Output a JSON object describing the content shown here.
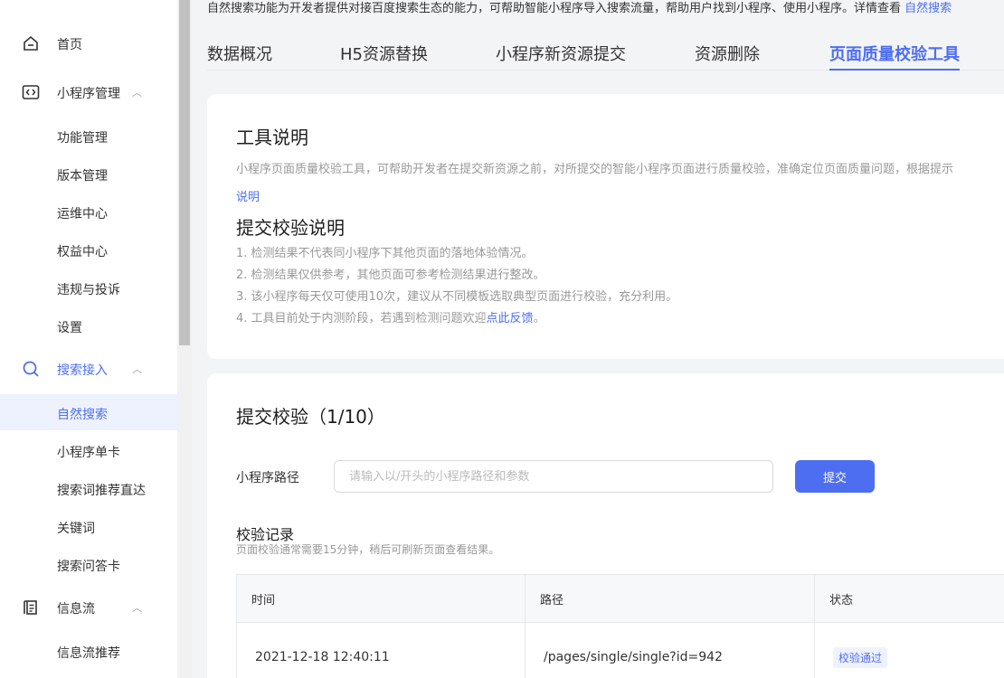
{
  "intro": {
    "text": "自然搜索功能为开发者提供对接百度搜索生态的能力，可帮助智能小程序导入搜索流量，帮助用户找到小程序、使用小程序。详情查看 ",
    "link": "自然搜索"
  },
  "sidebar": {
    "home": "首页",
    "groups": [
      {
        "label": "小程序管理",
        "icon": "code-brackets-icon",
        "items": [
          "功能管理",
          "版本管理",
          "运维中心",
          "权益中心",
          "违规与投诉",
          "设置"
        ]
      },
      {
        "label": "搜索接入",
        "icon": "search-icon",
        "items": [
          "自然搜索",
          "小程序单卡",
          "搜索词推荐直达",
          "关键词",
          "搜索问答卡"
        ]
      },
      {
        "label": "信息流",
        "icon": "list-icon",
        "items": [
          "信息流推荐"
        ]
      }
    ]
  },
  "tabs": [
    "数据概况",
    "H5资源替换",
    "小程序新资源提交",
    "资源删除",
    "页面质量校验工具"
  ],
  "tool": {
    "title": "工具说明",
    "desc": "小程序页面质量校验工具，可帮助开发者在提交新资源之前，对所提交的智能小程序页面进行质量校验，准确定位页面质量问题，根据提示",
    "desc_link": "说明"
  },
  "rules": {
    "title": "提交校验说明",
    "items": [
      "1. 检测结果不代表同小程序下其他页面的落地体验情况。",
      "2. 检测结果仅供参考，其他页面可参考检测结果进行整改。",
      "3. 该小程序每天仅可使用10次，建议从不同模板选取典型页面进行校验，充分利用。"
    ],
    "item4_prefix": "4. 工具目前处于内测阶段，若遇到检测问题欢迎",
    "item4_link": "点此反馈",
    "item4_suffix": "。"
  },
  "submit": {
    "title": "提交校验（1/10）",
    "path_label": "小程序路径",
    "placeholder": "请输入以/开头的小程序路径和参数",
    "button": "提交"
  },
  "records": {
    "title": "校验记录",
    "note": "页面校验通常需要15分钟，稍后可刷新页面查看结果。",
    "columns": [
      "时间",
      "路径",
      "状态"
    ],
    "rows": [
      {
        "time": "2021-12-18 12:40:11",
        "path": "/pages/single/single?id=942",
        "status": "校验通过"
      }
    ]
  },
  "colors": {
    "accent": "#4e6ef2",
    "active_bg": "#eef2fe",
    "page_bg": "#f3f4f6"
  }
}
